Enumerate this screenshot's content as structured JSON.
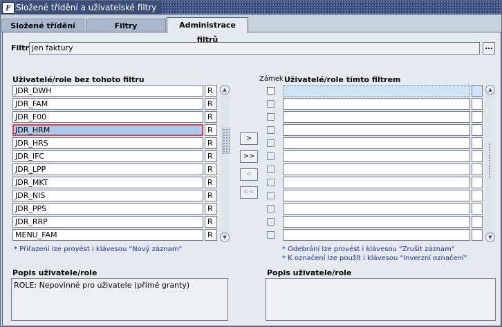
{
  "window": {
    "title": "Složené třídění a uživatelské filtry",
    "logo": "F"
  },
  "tabs": [
    {
      "label": "Složené třídění"
    },
    {
      "label": "Filtry"
    },
    {
      "label": "Administrace filtrů"
    }
  ],
  "filter": {
    "label": "Filtr",
    "value": "jen faktury",
    "lov_button": "..."
  },
  "left": {
    "header": "Uživatelé/role bez tohoto filtru",
    "rows": [
      {
        "name": "JDR_DWH",
        "type": "R"
      },
      {
        "name": "JDR_FAM",
        "type": "R"
      },
      {
        "name": "JDR_F00",
        "type": "R"
      },
      {
        "name": "JDR_HRM",
        "type": "R"
      },
      {
        "name": "JDR_HRS",
        "type": "R"
      },
      {
        "name": "JDR_IFC",
        "type": "R"
      },
      {
        "name": "JDR_LPP",
        "type": "R"
      },
      {
        "name": "JDR_MKT",
        "type": "R"
      },
      {
        "name": "JDR_NIS",
        "type": "R"
      },
      {
        "name": "JDR_PPS",
        "type": "R"
      },
      {
        "name": "JDR_RRP",
        "type": "R"
      },
      {
        "name": "MENU_FAM",
        "type": "R"
      }
    ],
    "note": "* Přiřazení lze provést i klávesou \"Nový záznam\"",
    "desc_label": "Popis uživatele/role",
    "desc_value": "ROLE: Nepovinné pro uživatele (přímé granty)"
  },
  "buttons": {
    "add": ">",
    "add_all": ">>",
    "remove": "<",
    "remove_all": "<<"
  },
  "right": {
    "lock_header": "Zámek",
    "header": "Uživatelé/role tímto filtrem",
    "note1": "* Odebrání lze provést i klávesou \"Zrušit záznam\"",
    "note2": "* K označení lze použít i klávesou \"Inverzní označení\"",
    "desc_label": "Popis uživatele/role",
    "desc_value": ""
  },
  "colors": {
    "title_bar": "#3b4e7a",
    "panel": "#e6eaf0",
    "selected": "#a8ccf0",
    "note": "#1a2ea0"
  }
}
